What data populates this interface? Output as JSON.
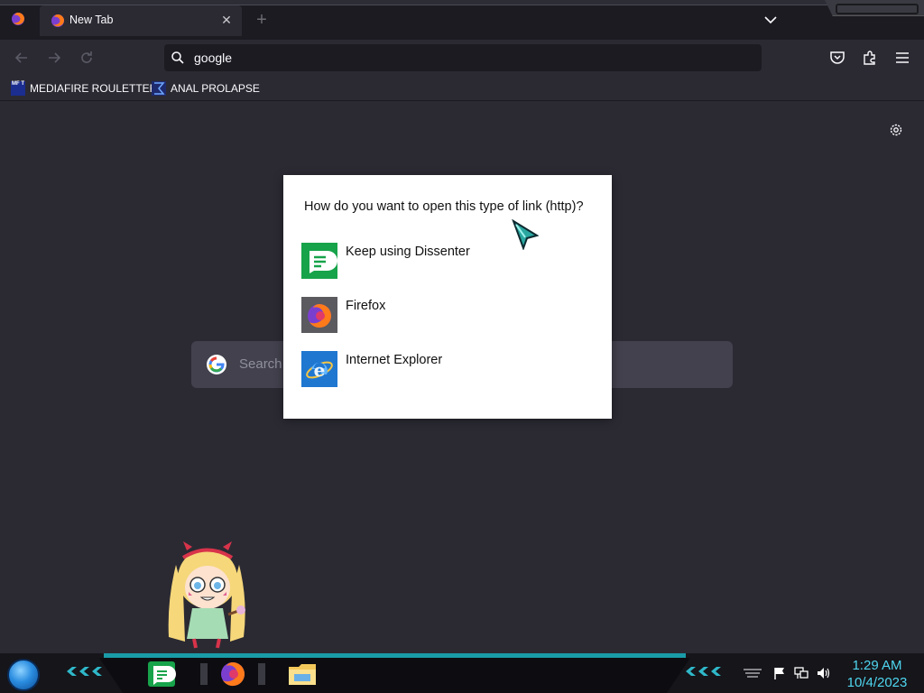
{
  "browser": {
    "tab": {
      "title": "New Tab"
    },
    "urlbar": {
      "value": "google"
    },
    "bookmarks": [
      {
        "label": "MEDIAFIRE ROULETTER",
        "icon": "mft-icon",
        "icon_text": "MF T"
      },
      {
        "label": "ANAL PROLAPSE",
        "icon": "bookmark-sigma-icon"
      }
    ],
    "newtab": {
      "search_placeholder": "Search"
    }
  },
  "dialog": {
    "question": "How do you want to open this type of link (http)?",
    "options": [
      {
        "label": "Keep using Dissenter",
        "icon": "dissenter-icon",
        "color": "#17a34a"
      },
      {
        "label": "Firefox",
        "icon": "firefox-icon",
        "color": "#5a5a5f"
      },
      {
        "label": "Internet Explorer",
        "icon": "internet-explorer-icon",
        "color": "#1f77d0"
      }
    ]
  },
  "taskbar": {
    "apps": [
      "dissenter-icon",
      "firefox-icon",
      "file-explorer-icon"
    ],
    "tray": [
      "action-center-flag-icon",
      "network-icon",
      "volume-icon"
    ],
    "clock": {
      "time": "1:29 AM",
      "date": "10/4/2023"
    }
  },
  "colors": {
    "page_bg": "#2b2a33",
    "tabstrip_bg": "#1c1b22",
    "accent": "#1a9ba8",
    "clock": "#4fd6ef"
  }
}
